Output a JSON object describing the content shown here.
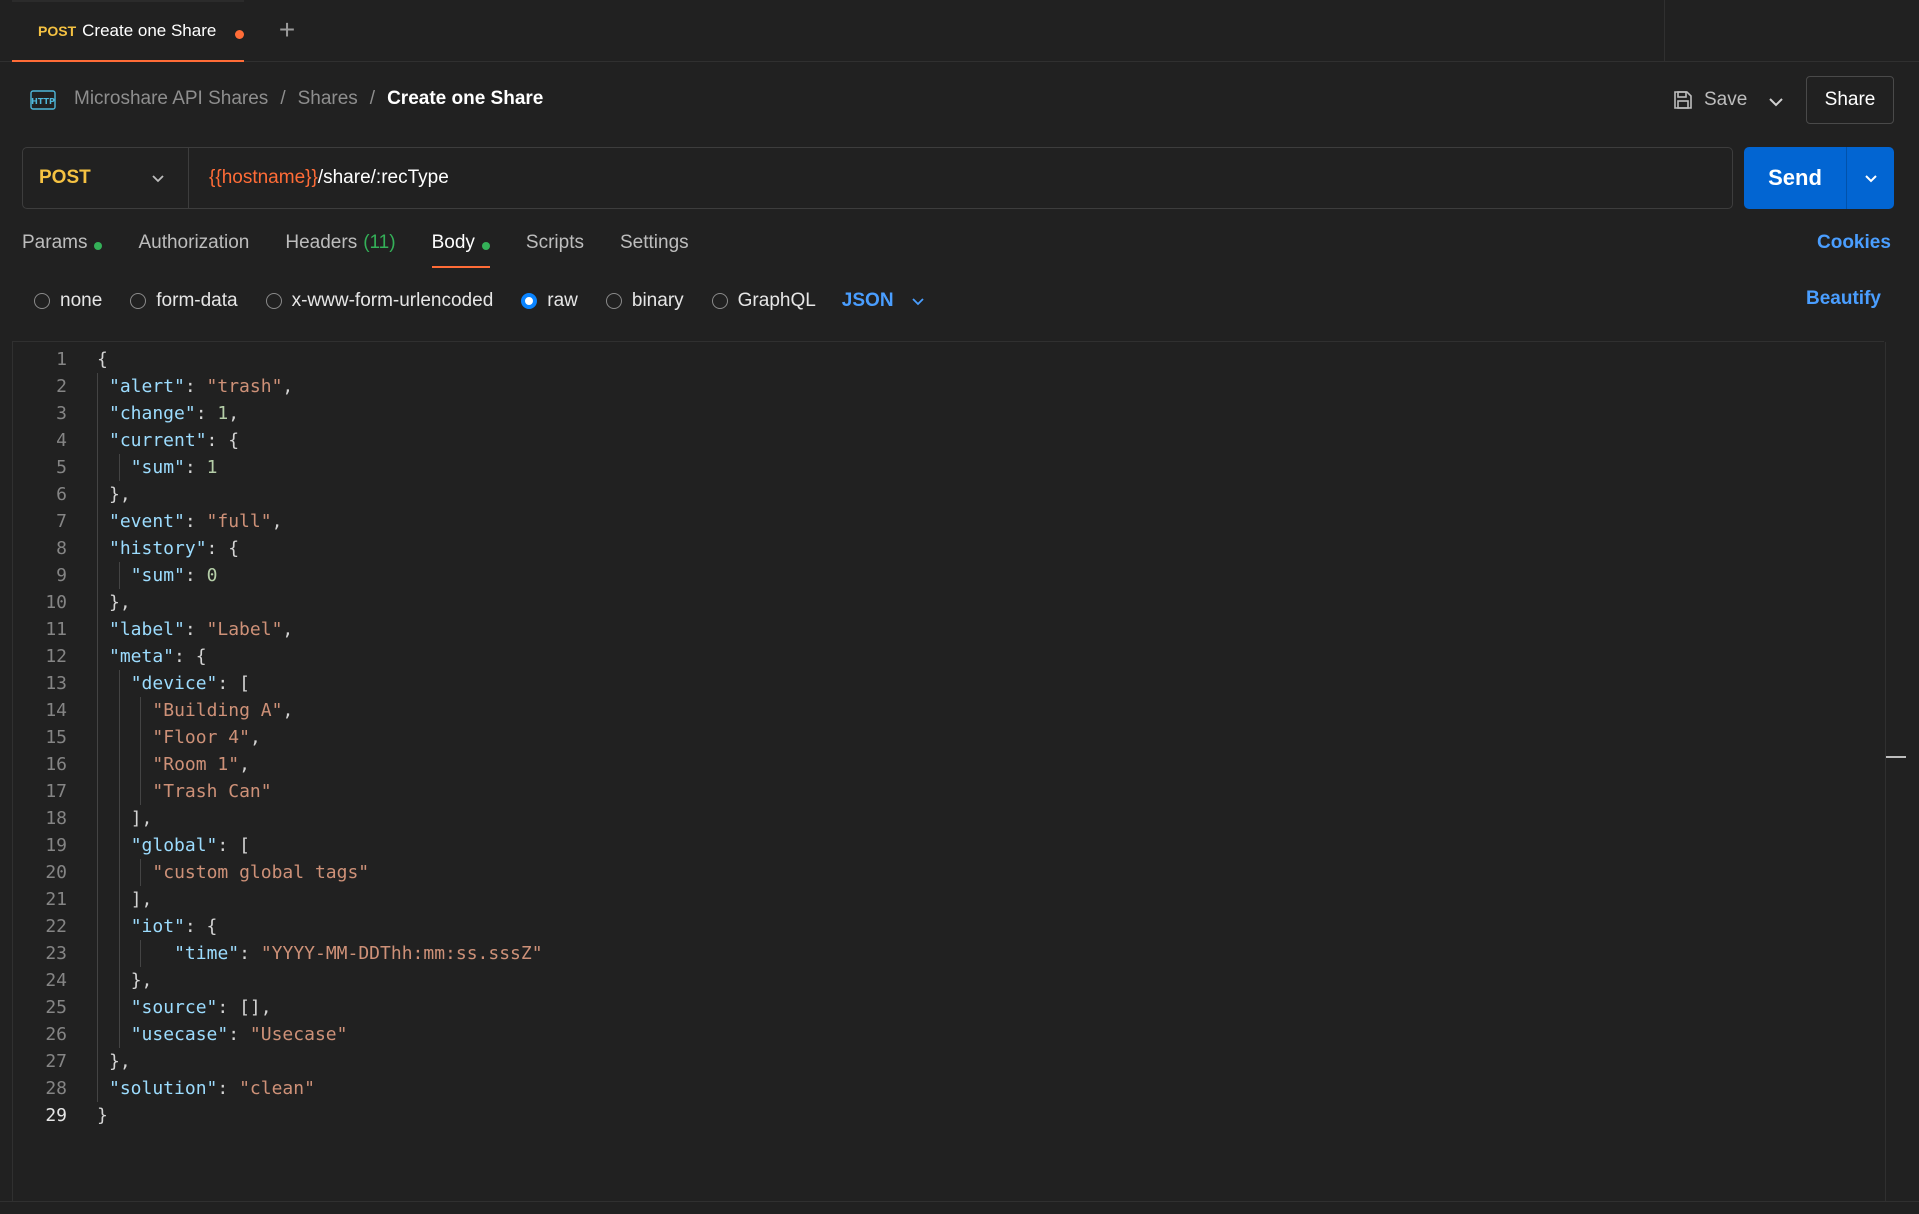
{
  "tab": {
    "method": "POST",
    "name": "Create one Share"
  },
  "breadcrumb": {
    "items": [
      "Microshare API Shares",
      "Shares"
    ],
    "current": "Create one Share",
    "separator": "/"
  },
  "actions": {
    "save_label": "Save",
    "share_label": "Share"
  },
  "request": {
    "method": "POST",
    "url_variable": "{{hostname}}",
    "url_path": "/share/:recType",
    "send_label": "Send"
  },
  "request_tabs": [
    {
      "label": "Params",
      "indicator": true
    },
    {
      "label": "Authorization"
    },
    {
      "label": "Headers",
      "count": "(11)"
    },
    {
      "label": "Body",
      "indicator": true,
      "active": true
    },
    {
      "label": "Scripts"
    },
    {
      "label": "Settings"
    }
  ],
  "cookies_label": "Cookies",
  "body_types": [
    {
      "label": "none",
      "checked": false
    },
    {
      "label": "form-data",
      "checked": false
    },
    {
      "label": "x-www-form-urlencoded",
      "checked": false
    },
    {
      "label": "raw",
      "checked": true
    },
    {
      "label": "binary",
      "checked": false
    },
    {
      "label": "GraphQL",
      "checked": false
    }
  ],
  "body_format": "JSON",
  "beautify_label": "Beautify",
  "colors": {
    "accent": "#ff6c37",
    "method": "#f5c242",
    "send": "#0265d2",
    "link": "#4a9eff",
    "indicator": "#34b058"
  },
  "editor": {
    "current_line": 29,
    "lines": [
      {
        "indent": 0,
        "guides": [],
        "tokens": [
          [
            "p",
            "{"
          ]
        ]
      },
      {
        "indent": 1,
        "guides": [
          0
        ],
        "tokens": [
          [
            "k",
            "\"alert\""
          ],
          [
            "p",
            ": "
          ],
          [
            "s",
            "\"trash\""
          ],
          [
            "p",
            ","
          ]
        ]
      },
      {
        "indent": 1,
        "guides": [
          0
        ],
        "tokens": [
          [
            "k",
            "\"change\""
          ],
          [
            "p",
            ": "
          ],
          [
            "n",
            "1"
          ],
          [
            "p",
            ","
          ]
        ]
      },
      {
        "indent": 1,
        "guides": [
          0
        ],
        "tokens": [
          [
            "k",
            "\"current\""
          ],
          [
            "p",
            ": {"
          ]
        ]
      },
      {
        "indent": 2,
        "guides": [
          0,
          1
        ],
        "tokens": [
          [
            "k",
            "\"sum\""
          ],
          [
            "p",
            ": "
          ],
          [
            "n",
            "1"
          ]
        ]
      },
      {
        "indent": 1,
        "guides": [
          0
        ],
        "tokens": [
          [
            "p",
            "},"
          ]
        ]
      },
      {
        "indent": 1,
        "guides": [
          0
        ],
        "tokens": [
          [
            "k",
            "\"event\""
          ],
          [
            "p",
            ": "
          ],
          [
            "s",
            "\"full\""
          ],
          [
            "p",
            ","
          ]
        ]
      },
      {
        "indent": 1,
        "guides": [
          0
        ],
        "tokens": [
          [
            "k",
            "\"history\""
          ],
          [
            "p",
            ": {"
          ]
        ]
      },
      {
        "indent": 2,
        "guides": [
          0,
          1
        ],
        "tokens": [
          [
            "k",
            "\"sum\""
          ],
          [
            "p",
            ": "
          ],
          [
            "n",
            "0"
          ]
        ]
      },
      {
        "indent": 1,
        "guides": [
          0
        ],
        "tokens": [
          [
            "p",
            "},"
          ]
        ]
      },
      {
        "indent": 1,
        "guides": [
          0
        ],
        "tokens": [
          [
            "k",
            "\"label\""
          ],
          [
            "p",
            ": "
          ],
          [
            "s",
            "\"Label\""
          ],
          [
            "p",
            ","
          ]
        ]
      },
      {
        "indent": 1,
        "guides": [
          0
        ],
        "tokens": [
          [
            "k",
            "\"meta\""
          ],
          [
            "p",
            ": {"
          ]
        ]
      },
      {
        "indent": 2,
        "guides": [
          0,
          1
        ],
        "tokens": [
          [
            "k",
            "\"device\""
          ],
          [
            "p",
            ": ["
          ]
        ]
      },
      {
        "indent": 3,
        "guides": [
          0,
          1,
          2
        ],
        "tokens": [
          [
            "s",
            "\"Building A\""
          ],
          [
            "p",
            ","
          ]
        ]
      },
      {
        "indent": 3,
        "guides": [
          0,
          1,
          2
        ],
        "tokens": [
          [
            "s",
            "\"Floor 4\""
          ],
          [
            "p",
            ","
          ]
        ]
      },
      {
        "indent": 3,
        "guides": [
          0,
          1,
          2
        ],
        "tokens": [
          [
            "s",
            "\"Room 1\""
          ],
          [
            "p",
            ","
          ]
        ]
      },
      {
        "indent": 3,
        "guides": [
          0,
          1,
          2
        ],
        "tokens": [
          [
            "s",
            "\"Trash Can\""
          ]
        ]
      },
      {
        "indent": 2,
        "guides": [
          0,
          1
        ],
        "tokens": [
          [
            "p",
            "],"
          ]
        ]
      },
      {
        "indent": 2,
        "guides": [
          0,
          1
        ],
        "tokens": [
          [
            "k",
            "\"global\""
          ],
          [
            "p",
            ": ["
          ]
        ]
      },
      {
        "indent": 3,
        "guides": [
          0,
          1,
          2
        ],
        "tokens": [
          [
            "s",
            "\"custom global tags\""
          ]
        ]
      },
      {
        "indent": 2,
        "guides": [
          0,
          1
        ],
        "tokens": [
          [
            "p",
            "],"
          ]
        ]
      },
      {
        "indent": 2,
        "guides": [
          0,
          1
        ],
        "tokens": [
          [
            "k",
            "\"iot\""
          ],
          [
            "p",
            ": {"
          ]
        ]
      },
      {
        "indent": 4,
        "guides": [
          0,
          1,
          2
        ],
        "tokens": [
          [
            "k",
            "\"time\""
          ],
          [
            "p",
            ": "
          ],
          [
            "s",
            "\"YYYY-MM-DDThh:mm:ss.sssZ\""
          ]
        ]
      },
      {
        "indent": 2,
        "guides": [
          0,
          1
        ],
        "tokens": [
          [
            "p",
            "},"
          ]
        ]
      },
      {
        "indent": 2,
        "guides": [
          0,
          1
        ],
        "tokens": [
          [
            "k",
            "\"source\""
          ],
          [
            "p",
            ": [],"
          ]
        ]
      },
      {
        "indent": 2,
        "guides": [
          0,
          1
        ],
        "tokens": [
          [
            "k",
            "\"usecase\""
          ],
          [
            "p",
            ": "
          ],
          [
            "s",
            "\"Usecase\""
          ]
        ]
      },
      {
        "indent": 1,
        "guides": [
          0
        ],
        "tokens": [
          [
            "p",
            "},"
          ]
        ]
      },
      {
        "indent": 1,
        "guides": [
          0
        ],
        "tokens": [
          [
            "k",
            "\"solution\""
          ],
          [
            "p",
            ": "
          ],
          [
            "s",
            "\"clean\""
          ]
        ]
      },
      {
        "indent": 0,
        "guides": [],
        "tokens": [
          [
            "p",
            "}"
          ]
        ]
      }
    ]
  }
}
